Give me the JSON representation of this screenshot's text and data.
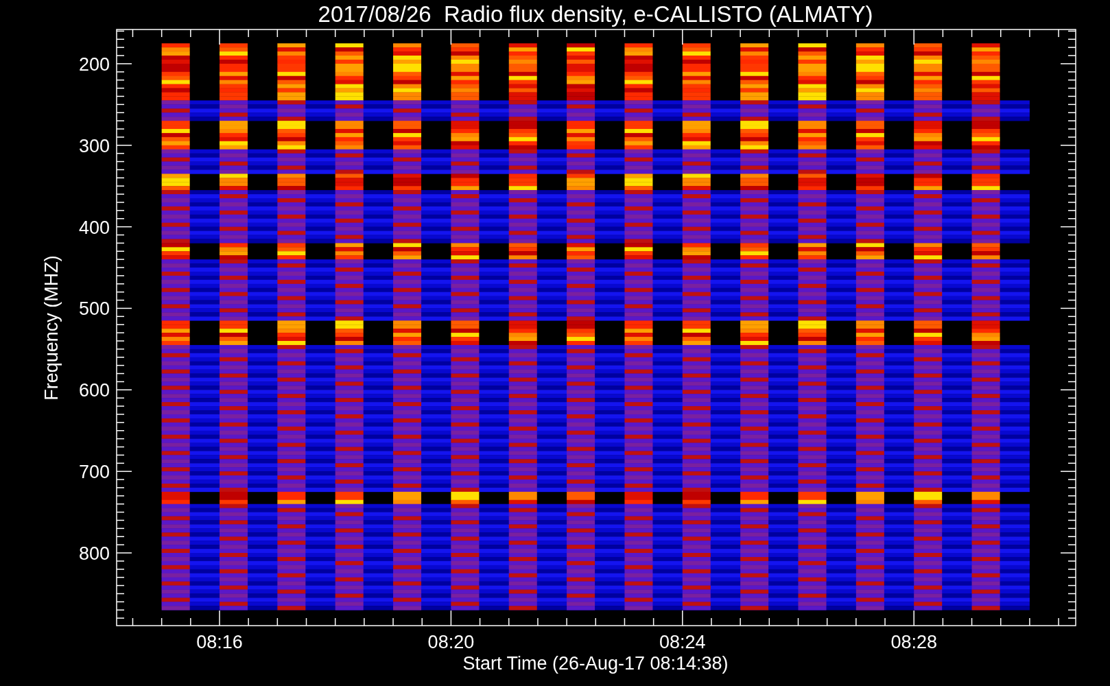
{
  "chart": {
    "title": "2017/08/26  Radio flux density, e-CALLISTO (ALMATY)",
    "xlabel": "Start Time (26-Aug-17 08:14:38)",
    "ylabel": "Frequency (MHZ)",
    "yticks": [
      "200",
      "300",
      "400",
      "500",
      "600",
      "700",
      "800"
    ],
    "xticks": [
      "08:16",
      "08:20",
      "08:24",
      "08:28"
    ]
  }
}
